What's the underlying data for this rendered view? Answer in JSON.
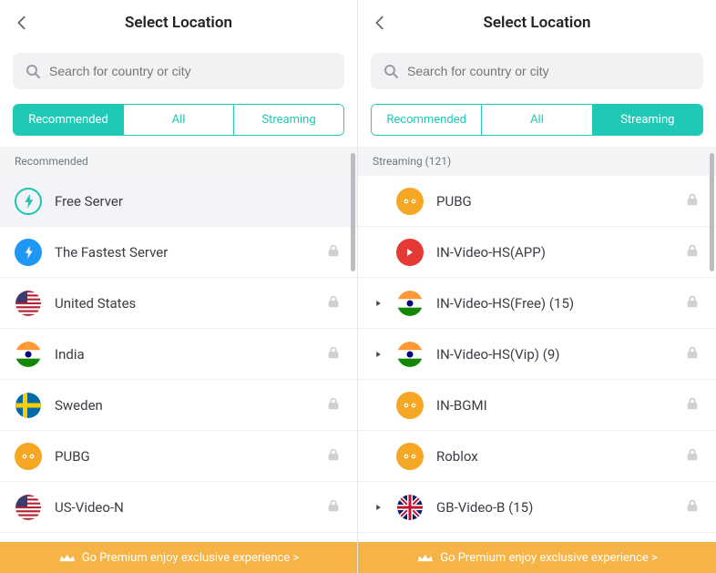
{
  "left": {
    "title": "Select Location",
    "search_placeholder": "Search for country or city",
    "tabs": {
      "recommended": "Recommended",
      "all": "All",
      "streaming": "Streaming",
      "active": "recommended"
    },
    "section_label": "Recommended",
    "rows": [
      {
        "icon": "bolt-outline",
        "label": "Free Server",
        "locked": false,
        "highlight": true
      },
      {
        "icon": "bolt-fill",
        "label": "The Fastest Server",
        "locked": true
      },
      {
        "icon": "flag-us",
        "label": "United States",
        "locked": true
      },
      {
        "icon": "flag-in",
        "label": "India",
        "locked": true
      },
      {
        "icon": "flag-se",
        "label": "Sweden",
        "locked": true
      },
      {
        "icon": "game-orange",
        "label": "PUBG",
        "locked": true
      },
      {
        "icon": "flag-us",
        "label": "US-Video-N",
        "locked": true
      }
    ],
    "premium_text": "Go Premium enjoy exclusive experience >"
  },
  "right": {
    "title": "Select Location",
    "search_placeholder": "Search for country or city",
    "tabs": {
      "recommended": "Recommended",
      "all": "All",
      "streaming": "Streaming",
      "active": "streaming"
    },
    "section_label": "Streaming (121)",
    "rows": [
      {
        "icon": "game-orange",
        "label": "PUBG",
        "locked": true,
        "spacer": true
      },
      {
        "icon": "play-red",
        "label": "IN-Video-HS(APP)",
        "locked": true,
        "spacer": true
      },
      {
        "icon": "flag-in",
        "label": "IN-Video-HS(Free) (15)",
        "locked": true,
        "expandable": true
      },
      {
        "icon": "flag-in",
        "label": "IN-Video-HS(Vip) (9)",
        "locked": true,
        "expandable": true
      },
      {
        "icon": "game-orange",
        "label": "IN-BGMI",
        "locked": true,
        "spacer": true
      },
      {
        "icon": "game-orange",
        "label": "Roblox",
        "locked": true,
        "spacer": true
      },
      {
        "icon": "flag-gb",
        "label": "GB-Video-B (15)",
        "locked": true,
        "expandable": true
      }
    ],
    "premium_text": "Go Premium enjoy exclusive experience >"
  }
}
